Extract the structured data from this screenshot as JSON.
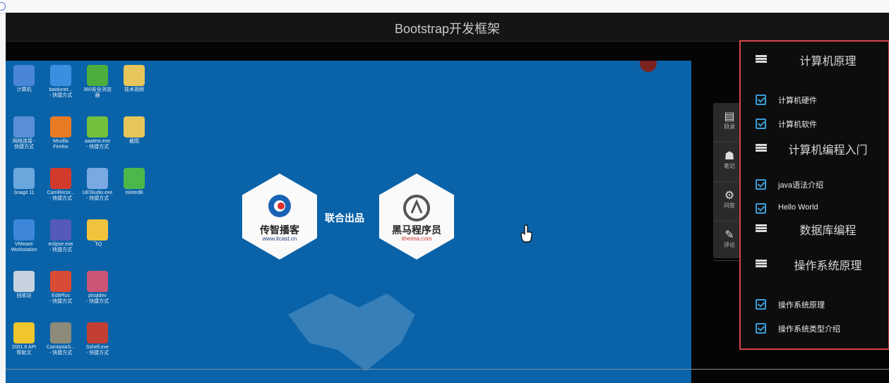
{
  "window": {
    "title": "Bootstrap开发框架"
  },
  "desktop_icons": [
    {
      "label": "计算机",
      "color": "#4a86d8"
    },
    {
      "label": "baidunet...\n- 快捷方式",
      "color": "#3b8fe0"
    },
    {
      "label": "360安全浏览\n器",
      "color": "#4cae3d"
    },
    {
      "label": "技术视频",
      "color": "#e6c65a"
    },
    {
      "label": "网络连接 -\n快捷方式",
      "color": "#5a8fd6"
    },
    {
      "label": "Mozilla\nFirefox",
      "color": "#e77a24"
    },
    {
      "label": "aaatest.exe\n- 快捷方式",
      "color": "#72c03c"
    },
    {
      "label": "截图",
      "color": "#e6c65a"
    },
    {
      "label": "Snagit 11",
      "color": "#6aa7dd"
    },
    {
      "label": "CamRecor...\n- 快捷方式",
      "color": "#d23a2c"
    },
    {
      "label": "UEStudio.exe\n- 快捷方式",
      "color": "#7aa8e2"
    },
    {
      "label": "IsletedB",
      "color": "#4db84a"
    },
    {
      "label": "VMware\nWorkstation",
      "color": "#3d86d9"
    },
    {
      "label": "eclipse.exe\n- 快捷方式",
      "color": "#5559b8"
    },
    {
      "label": "飞Q",
      "color": "#f1c23b"
    },
    {
      "label": "回收站",
      "color": "#c6d3de"
    },
    {
      "label": "EditPlus\n- 快捷方式",
      "color": "#d94b34"
    },
    {
      "label": "plsqldev\n- 快捷方式",
      "color": "#cc5576"
    },
    {
      "label": "2001.6 API\n帮助文",
      "color": "#f0c52e"
    },
    {
      "label": "CamtasiaS...\n- 快捷方式",
      "color": "#8e8a7a"
    },
    {
      "label": "Sshell.exe\n- 快捷方式",
      "color": "#c33f33"
    }
  ],
  "center": {
    "left_brand": {
      "name": "传智播客",
      "url": "www.itcast.cn"
    },
    "joint_text": "联合出品",
    "right_brand": {
      "name": "黑马程序员",
      "url": "itheima.com"
    }
  },
  "side_tools": [
    {
      "icon": "notes-icon",
      "label": "目录"
    },
    {
      "icon": "user-icon",
      "label": "笔记"
    },
    {
      "icon": "gear-icon",
      "label": "问答"
    },
    {
      "icon": "comment-icon",
      "label": "评论"
    }
  ],
  "menu": {
    "sections": [
      {
        "heading": "计算机原理",
        "items": [
          "计算机硬件",
          "计算机软件"
        ]
      },
      {
        "heading": "计算机编程入门",
        "items": [
          "java语法介绍",
          "Hello World"
        ]
      },
      {
        "heading": "数据库编程",
        "items": []
      },
      {
        "heading": "操作系统原理",
        "items": [
          "操作系统原理",
          "操作系统类型介绍"
        ]
      }
    ]
  },
  "colors": {
    "menu_border": "#d5454a",
    "check_blue": "#3a9ed8",
    "desktop_blue": "#0a63a9"
  }
}
